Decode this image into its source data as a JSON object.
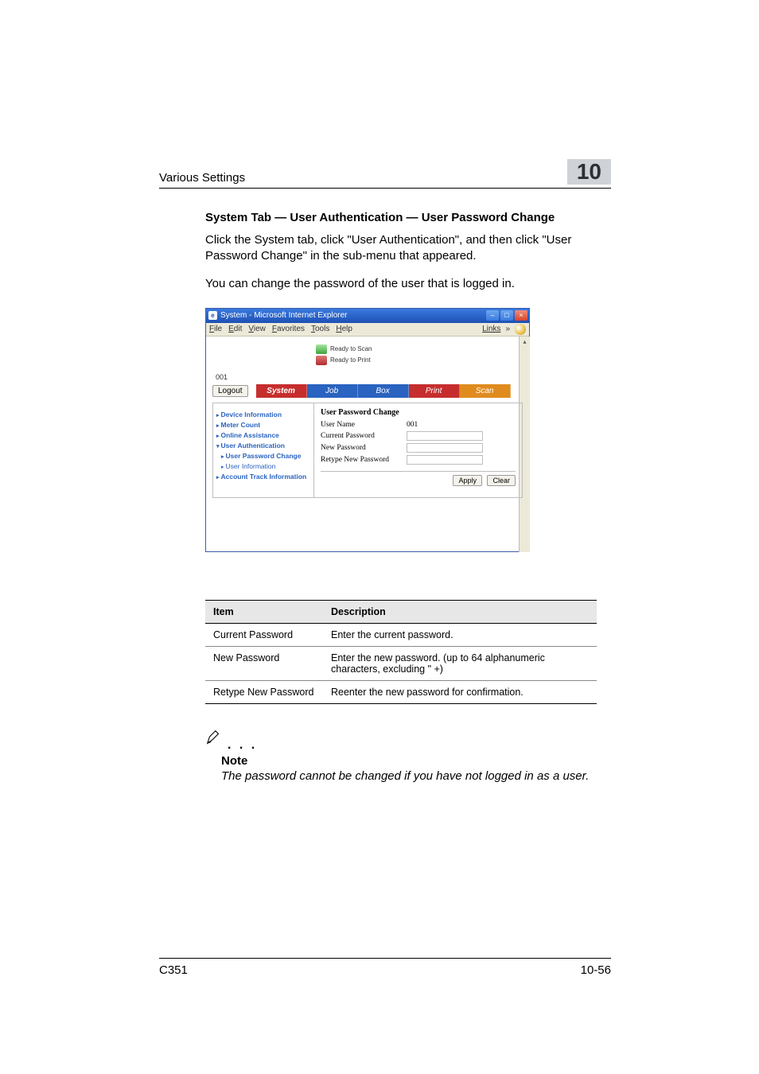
{
  "header": {
    "running_title": "Various Settings",
    "chapter_number": "10"
  },
  "section": {
    "heading": "System Tab — User Authentication — User Password Change",
    "para1": "Click the System tab, click \"User Authentication\", and then click \"User Password Change\" in the sub-menu that appeared.",
    "para2": "You can change the password of the user that is logged in."
  },
  "ie": {
    "title": "System - Microsoft Internet Explorer",
    "menus": {
      "file": "File",
      "edit": "Edit",
      "view": "View",
      "favorites": "Favorites",
      "tools": "Tools",
      "help": "Help"
    },
    "links_label": "Links",
    "status": {
      "scan": "Ready to Scan",
      "print": "Ready to Print"
    },
    "user_line": "001",
    "logout": "Logout",
    "tabs": {
      "system": "System",
      "job": "Job",
      "box": "Box",
      "print": "Print",
      "scan": "Scan"
    },
    "sidebar": {
      "items": [
        {
          "label": "Device Information"
        },
        {
          "label": "Meter Count"
        },
        {
          "label": "Online Assistance"
        },
        {
          "label": "User Authentication"
        },
        {
          "label": "User Password Change"
        },
        {
          "label": "User Information"
        },
        {
          "label": "Account Track Information"
        }
      ]
    },
    "form": {
      "title": "User Password Change",
      "user_name_label": "User Name",
      "user_name_value": "001",
      "current_pwd_label": "Current Password",
      "new_pwd_label": "New Password",
      "retype_pwd_label": "Retype New Password",
      "apply": "Apply",
      "clear": "Clear"
    }
  },
  "table": {
    "head": {
      "item": "Item",
      "desc": "Description"
    },
    "rows": [
      {
        "item": "Current Password",
        "desc": "Enter the current password."
      },
      {
        "item": "New Password",
        "desc": "Enter the new password. (up to 64 alphanumeric characters, excluding \" +)"
      },
      {
        "item": "Retype New Password",
        "desc": "Reenter the new password for confirmation."
      }
    ]
  },
  "note": {
    "heading": "Note",
    "body": "The password cannot be changed if you have not logged in as a user."
  },
  "footer": {
    "model": "C351",
    "page": "10-56"
  }
}
